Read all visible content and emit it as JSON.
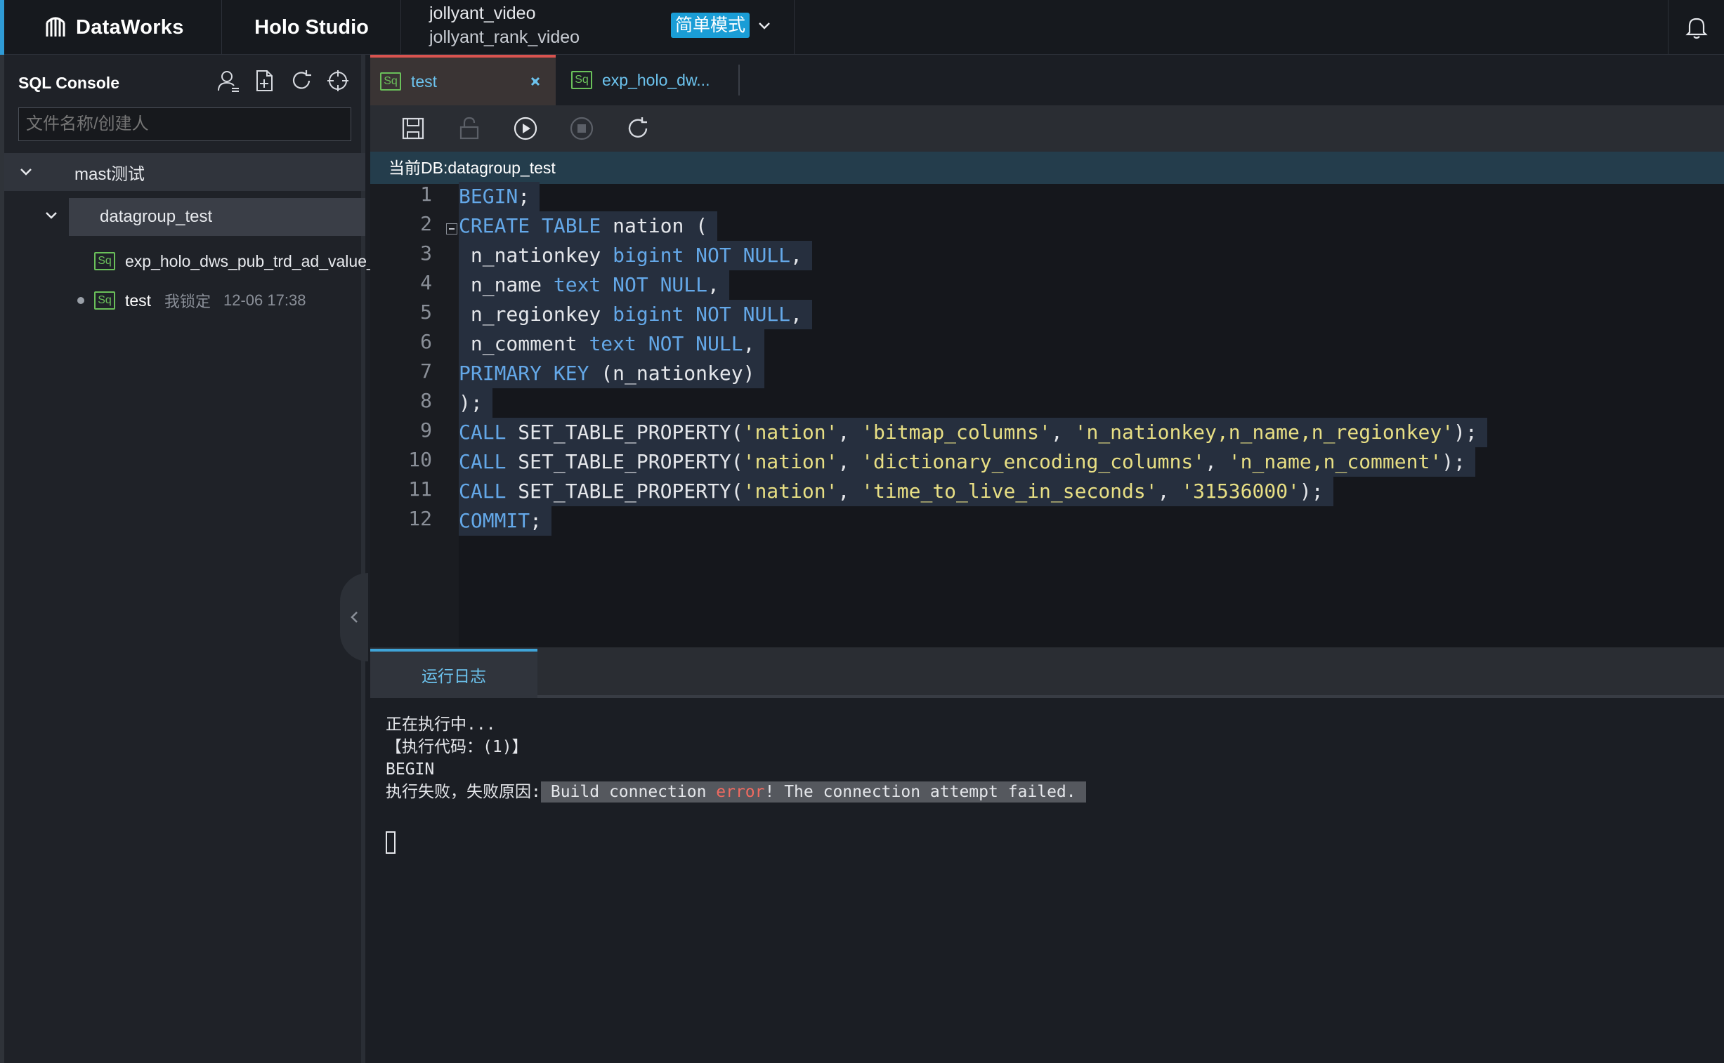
{
  "topbar": {
    "brand": "DataWorks",
    "studio": "Holo Studio",
    "project_name": "jollyant_video",
    "project_sub": "jollyant_rank_video",
    "mode_label": "简单模式",
    "icons": [
      "dataworks-logo-icon",
      "chevron-down-icon",
      "bell-icon"
    ]
  },
  "sidebar": {
    "title": "SQL Console",
    "icons": [
      "user-icon",
      "new-file-icon",
      "refresh-icon",
      "locate-icon"
    ],
    "search_placeholder": "文件名称/创建人",
    "folder": "mast测试",
    "database": "datagroup_test",
    "files": [
      {
        "type": "Sq",
        "name": "exp_holo_dws_pub_trd_ad_value_"
      },
      {
        "type": "Sq",
        "name": "test",
        "lock": "我锁定",
        "time": "12-06 17:38"
      }
    ]
  },
  "tabs": [
    {
      "type": "Sq",
      "label": "test",
      "active": true
    },
    {
      "type": "Sq",
      "label": "exp_holo_dw...",
      "active": false
    }
  ],
  "toolbar": {
    "icons": [
      "save-icon",
      "unlock-icon",
      "run-icon",
      "stop-icon",
      "refresh-icon"
    ]
  },
  "current_db": "当前DB:datagroup_test",
  "editor": {
    "line_numbers": [
      "1",
      "2",
      "3",
      "4",
      "5",
      "6",
      "7",
      "8",
      "9",
      "10",
      "11",
      "12"
    ],
    "lines": [
      [
        {
          "t": "BEGIN",
          "c": "kw"
        },
        {
          "t": ";",
          "c": ""
        }
      ],
      [
        {
          "t": "CREATE TABLE",
          "c": "kw"
        },
        {
          "t": " nation (",
          "c": ""
        }
      ],
      [
        {
          "t": " n_nationkey ",
          "c": ""
        },
        {
          "t": "bigint NOT NULL",
          "c": "kw"
        },
        {
          "t": ",",
          "c": ""
        }
      ],
      [
        {
          "t": " n_name ",
          "c": ""
        },
        {
          "t": "text NOT NULL",
          "c": "kw"
        },
        {
          "t": ",",
          "c": ""
        }
      ],
      [
        {
          "t": " n_regionkey ",
          "c": ""
        },
        {
          "t": "bigint NOT NULL",
          "c": "kw"
        },
        {
          "t": ",",
          "c": ""
        }
      ],
      [
        {
          "t": " n_comment ",
          "c": ""
        },
        {
          "t": "text NOT NULL",
          "c": "kw"
        },
        {
          "t": ",",
          "c": ""
        }
      ],
      [
        {
          "t": "PRIMARY KEY",
          "c": "kw"
        },
        {
          "t": " (n_nationkey)",
          "c": ""
        }
      ],
      [
        {
          "t": ");",
          "c": ""
        }
      ],
      [
        {
          "t": "CALL",
          "c": "kw"
        },
        {
          "t": " SET_TABLE_PROPERTY(",
          "c": ""
        },
        {
          "t": "'nation'",
          "c": "str"
        },
        {
          "t": ", ",
          "c": ""
        },
        {
          "t": "'bitmap_columns'",
          "c": "str"
        },
        {
          "t": ", ",
          "c": ""
        },
        {
          "t": "'n_nationkey,n_name,n_regionkey'",
          "c": "str"
        },
        {
          "t": ");",
          "c": ""
        }
      ],
      [
        {
          "t": "CALL",
          "c": "kw"
        },
        {
          "t": " SET_TABLE_PROPERTY(",
          "c": ""
        },
        {
          "t": "'nation'",
          "c": "str"
        },
        {
          "t": ", ",
          "c": ""
        },
        {
          "t": "'dictionary_encoding_columns'",
          "c": "str"
        },
        {
          "t": ", ",
          "c": ""
        },
        {
          "t": "'n_name,n_comment'",
          "c": "str"
        },
        {
          "t": ");",
          "c": ""
        }
      ],
      [
        {
          "t": "CALL",
          "c": "kw"
        },
        {
          "t": " SET_TABLE_PROPERTY(",
          "c": ""
        },
        {
          "t": "'nation'",
          "c": "str"
        },
        {
          "t": ", ",
          "c": ""
        },
        {
          "t": "'time_to_live_in_seconds'",
          "c": "str"
        },
        {
          "t": ", ",
          "c": ""
        },
        {
          "t": "'31536000'",
          "c": "str"
        },
        {
          "t": ");",
          "c": ""
        }
      ],
      [
        {
          "t": "COMMIT",
          "c": "kw"
        },
        {
          "t": ";",
          "c": ""
        }
      ]
    ]
  },
  "log": {
    "tab_label": "运行日志",
    "line1": "正在执行中...",
    "line2": "【执行代码：(1)】",
    "line3": "BEGIN",
    "fail_prefix": "执行失败，失败原因:",
    "fail_part1": "Build connection ",
    "fail_error": "error",
    "fail_part2": "! The connection attempt failed."
  },
  "colors": {
    "accent": "#2f9bd6",
    "active_tab_border": "#d9534f",
    "keyword": "#64a8e8",
    "string": "#e8df84",
    "error": "#ef6a60",
    "sql_file_icon": "#6ac05a"
  }
}
